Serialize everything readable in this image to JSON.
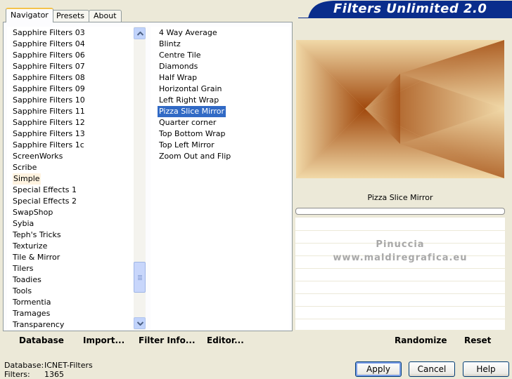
{
  "tabs": [
    {
      "label": "Navigator",
      "active": true
    },
    {
      "label": "Presets",
      "active": false
    },
    {
      "label": "About",
      "active": false
    }
  ],
  "banner": {
    "title": "Filters Unlimited 2.0",
    "color": "#0a2d8c"
  },
  "categories": {
    "items": [
      "Sapphire Filters 03",
      "Sapphire Filters 04",
      "Sapphire Filters 06",
      "Sapphire Filters 07",
      "Sapphire Filters 08",
      "Sapphire Filters 09",
      "Sapphire Filters 10",
      "Sapphire Filters 11",
      "Sapphire Filters 12",
      "Sapphire Filters 13",
      "Sapphire Filters 1c",
      "ScreenWorks",
      "Scribe",
      "Simple",
      "Special Effects 1",
      "Special Effects 2",
      "SwapShop",
      "Sybia",
      "Teph's Tricks",
      "Texturize",
      "Tile & Mirror",
      "Tilers",
      "Toadies",
      "Tools",
      "Tormentia",
      "Tramages",
      "Transparency"
    ],
    "hovered": "Simple"
  },
  "filters": {
    "items": [
      "4 Way Average",
      "Blintz",
      "Centre Tile",
      "Diamonds",
      "Half Wrap",
      "Horizontal Grain",
      "Left Right Wrap",
      "Pizza Slice Mirror",
      "Quarter corner",
      "Top Bottom Wrap",
      "Top Left Mirror",
      "Zoom Out and Flip"
    ],
    "selected": "Pizza Slice Mirror"
  },
  "preview": {
    "filter_name": "Pizza Slice Mirror",
    "progress": 0,
    "watermark_line1": "Pinuccia",
    "watermark_line2": "www.maldiregrafica.eu",
    "colors": {
      "light": "#f1d9a8",
      "dark": "#a0480c"
    }
  },
  "toolbar": {
    "database": "Database",
    "import": "Import...",
    "filter_info": "Filter Info...",
    "editor": "Editor...",
    "randomize": "Randomize",
    "reset": "Reset"
  },
  "status": {
    "database_label": "Database:",
    "database_value": "ICNET-Filters",
    "filters_label": "Filters:",
    "filters_value": "1365"
  },
  "buttons": {
    "apply": "Apply",
    "cancel": "Cancel",
    "help": "Help"
  }
}
